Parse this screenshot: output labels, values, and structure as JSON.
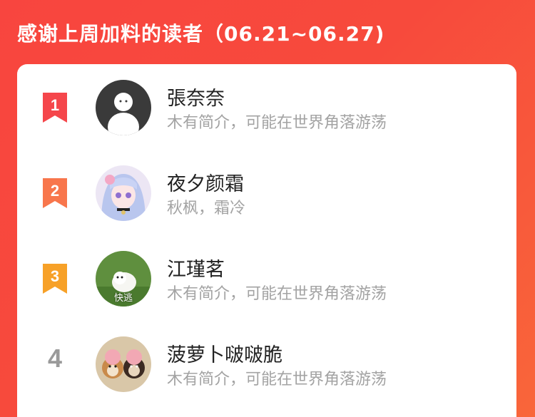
{
  "header": {
    "title": "感谢上周加料的读者（06.21~06.27)"
  },
  "colors": {
    "banner": "#f8453f",
    "rank1": "#f5464b",
    "rank2": "#f8764c",
    "rank3": "#f7a128",
    "rank_plain": "#9a9a9a"
  },
  "readers": [
    {
      "rank": "1",
      "name": "張奈奈",
      "desc": "木有简介，可能在世界角落游荡",
      "avatar": "default-avatar-icon"
    },
    {
      "rank": "2",
      "name": "夜夕颜霜",
      "desc": "秋枫，霜冷",
      "avatar": "anime-girl-avatar"
    },
    {
      "rank": "3",
      "name": "江瑾茗",
      "desc": "木有简介，可能在世界角落游荡",
      "avatar": "white-dog-avatar",
      "avatar_caption": "快逃"
    },
    {
      "rank": "4",
      "name": "菠萝卜啵啵脆",
      "desc": "木有简介，可能在世界角落游荡",
      "avatar": "two-dogs-avatar"
    }
  ]
}
